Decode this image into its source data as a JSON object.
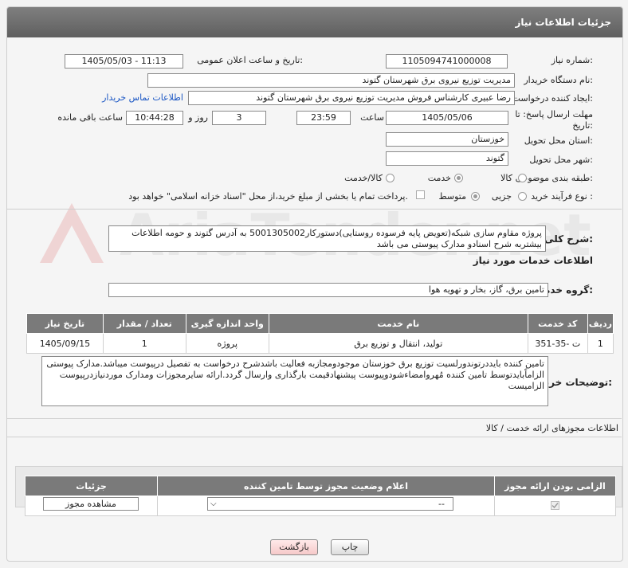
{
  "header": {
    "title": "جزئیات اطلاعات نیاز"
  },
  "fields": {
    "need_number_label": "شماره نیاز:",
    "need_number": "1105094741000008",
    "announce_label": "تاریخ و ساعت اعلان عمومی:",
    "announce_value": "1405/05/03 - 11:13",
    "buyer_org_label": "نام دستگاه خریدار:",
    "buyer_org": "مدیریت توزیع نیروی برق شهرستان گتوند",
    "creator_label": "ایجاد کننده درخواست:",
    "creator": "رضا عبیری کارشناس فروش مدیریت توزیع نیروی برق شهرستان گتوند",
    "contact_link": "اطلاعات تماس خریدار",
    "deadline_label_1": "مهلت ارسال پاسخ: تا",
    "deadline_label_2": "تاریخ:",
    "deadline_date": "1405/05/06",
    "time_label": "ساعت",
    "deadline_time": "23:59",
    "days_value": "3",
    "days_label": "روز و",
    "remaining_time": "10:44:28",
    "remaining_label": "ساعت باقی مانده",
    "province_label": "استان محل تحویل:",
    "province": "خوزستان",
    "city_label": "شهر محل تحویل:",
    "city": "گتوند",
    "category_label": "طبقه بندی موضوعی:",
    "category_options": [
      "کالا",
      "خدمت",
      "کالا/خدمت"
    ],
    "process_label": "نوع فرآیند خرید :",
    "process_options": [
      "جزیی",
      "متوسط"
    ],
    "payment_note": "پرداخت تمام یا بخشی از مبلغ خرید،از محل \"اسناد خزانه اسلامی\" خواهد بود."
  },
  "description": {
    "label": "شرح کلی نیاز:",
    "text": "پروژه مقاوم سازی  شبکه(تعویض پایه فرسوده روستایی)دستورکار5001305002 به آدرس گتوند و حومه اطلاعات بیشتربه شرح اسنادو مدارک پیوستی می باشد"
  },
  "services": {
    "section_title": "اطلاعات خدمات مورد نیاز",
    "group_label": "گروه خدمت:",
    "group_value": "تامین برق، گاز، بخار و تهویه هوا",
    "columns": [
      "ردیف",
      "کد خدمت",
      "نام خدمت",
      "واحد اندازه گیری",
      "تعداد / مقدار",
      "تاریخ نیاز"
    ],
    "rows": [
      [
        "1",
        "ت -35-351",
        "تولید، انتقال و توزیع برق",
        "پروژه",
        "1",
        "1405/09/15"
      ]
    ]
  },
  "buyer_notes": {
    "label": "توضیحات خریدار:",
    "text": "تامین کننده بایددرتوندورلسیت توزیع برق خوزستان موجودومجازبه فعالیت باشدشرح درخواست به تفصیل درپیوست میباشد.مدارک پیوستی الزاماًبایدتوسط تامین کننده مُهروامضاءشودوپیوست پیشنهادقیمت بارگذاری وارسال گردد.ارائه سایرمجوزات ومدارک موردنیازدرپیوست الزامیست"
  },
  "permits": {
    "section_title": "اطلاعات مجوزهای ارائه خدمت / کالا",
    "columns": [
      "الزامی بودن ارائه مجوز",
      "اعلام وضعیت مجوز توسط تامین کننده",
      "جزئیات"
    ],
    "select_value": "--",
    "view_button": "مشاهده مجوز"
  },
  "footer": {
    "print_button": "چاپ",
    "back_button": "بازگشت"
  },
  "watermark_text": "AriaTender.net"
}
